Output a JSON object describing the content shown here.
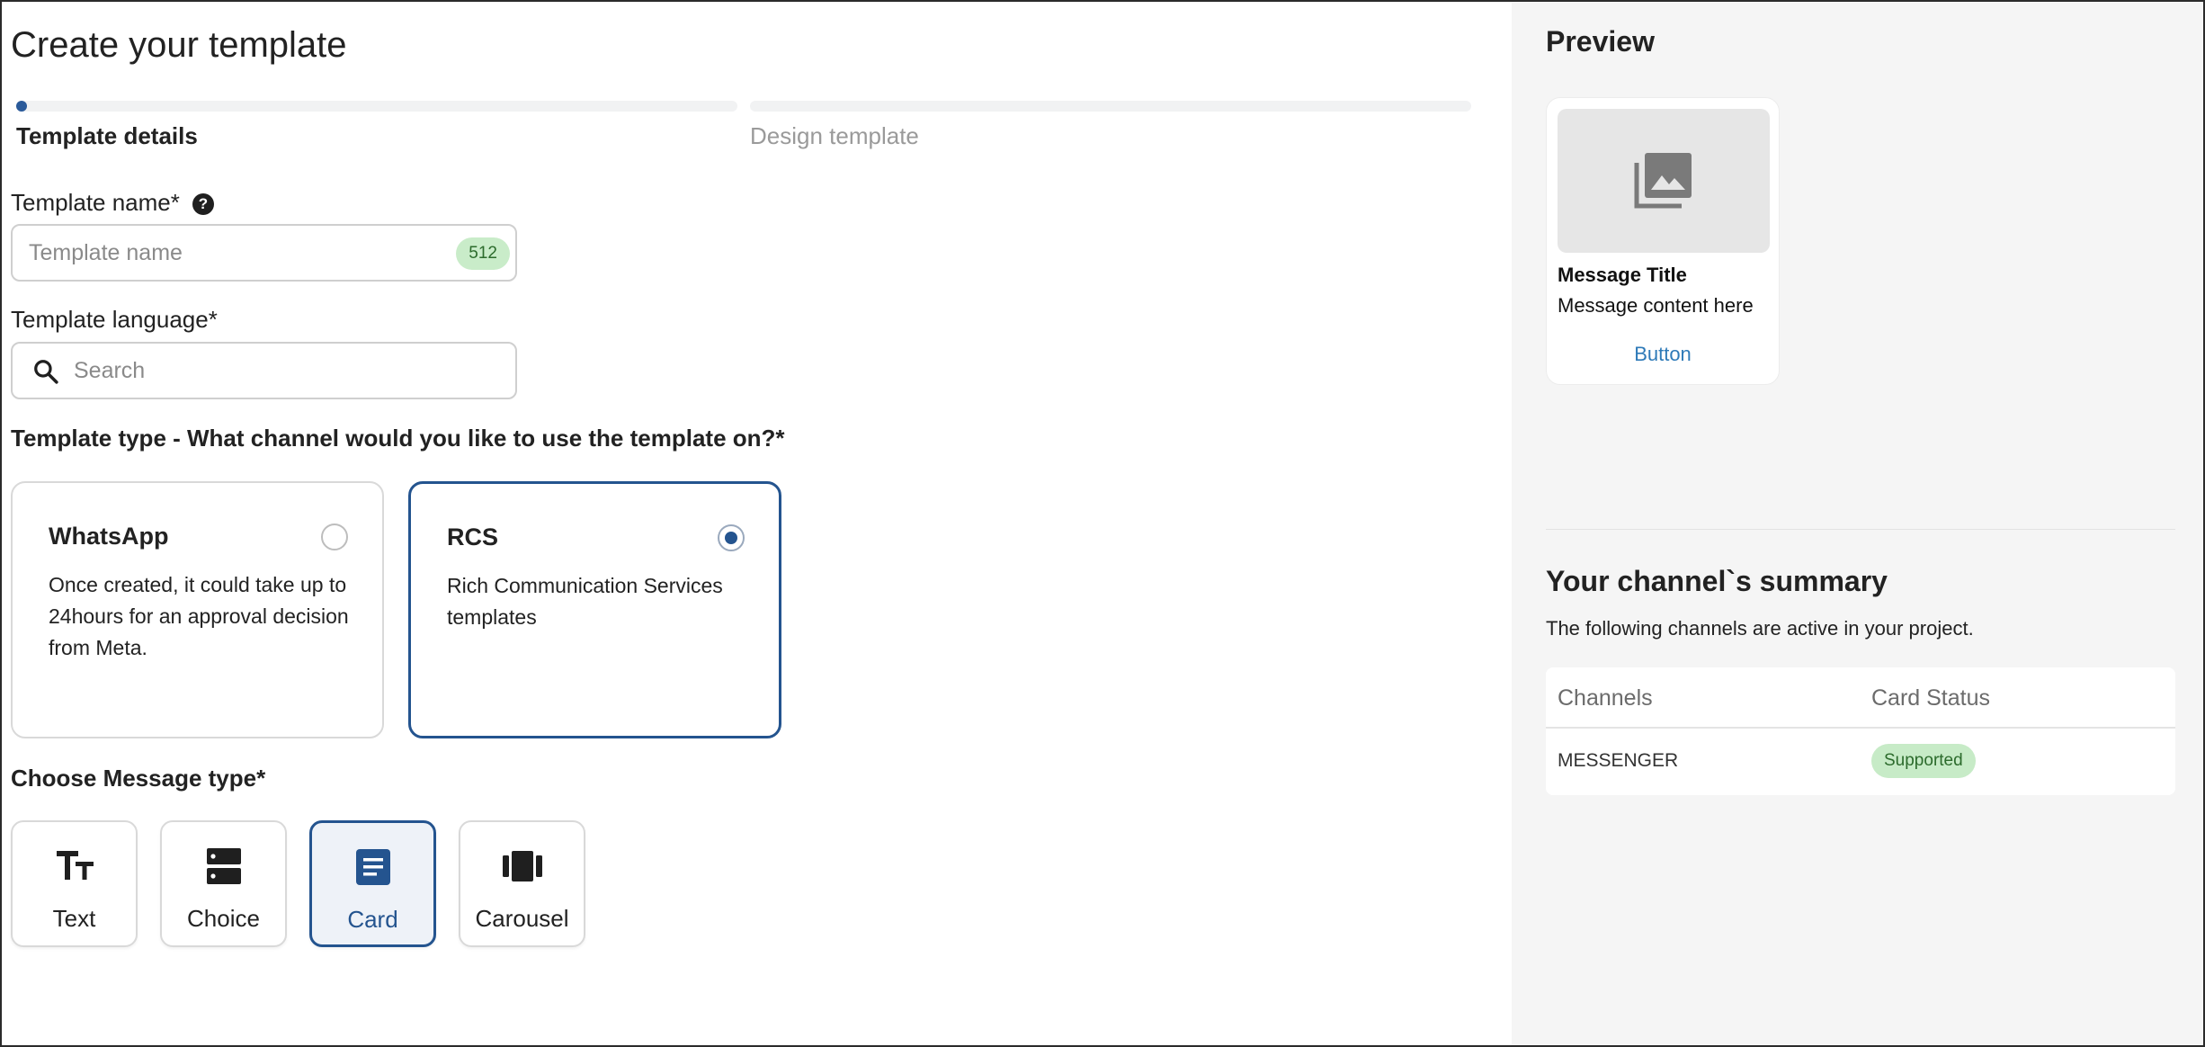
{
  "page_title": "Create your template",
  "steps": [
    {
      "label": "Template details",
      "active": true
    },
    {
      "label": "Design template",
      "active": false
    }
  ],
  "template_name": {
    "label": "Template name*",
    "placeholder": "Template name",
    "value": "",
    "counter": "512",
    "help_icon": "question-circle-icon"
  },
  "template_language": {
    "label": "Template language*",
    "placeholder": "Search",
    "value": "",
    "icon": "search-icon"
  },
  "template_type": {
    "question": "Template type - What channel would you like to use the template on?*",
    "options": [
      {
        "title": "WhatsApp",
        "description": "Once created, it could take up to 24hours for an approval decision from Meta.",
        "selected": false
      },
      {
        "title": "RCS",
        "description": "Rich Communication Services templates",
        "selected": true
      }
    ]
  },
  "message_type": {
    "label": "Choose Message type*",
    "options": [
      {
        "label": "Text",
        "icon": "text-format-icon",
        "selected": false
      },
      {
        "label": "Choice",
        "icon": "choice-list-icon",
        "selected": false
      },
      {
        "label": "Card",
        "icon": "card-article-icon",
        "selected": true
      },
      {
        "label": "Carousel",
        "icon": "carousel-icon",
        "selected": false
      }
    ]
  },
  "preview": {
    "title": "Preview",
    "media_icon": "image-placeholder-icon",
    "card_title": "Message Title",
    "card_content": "Message content here",
    "card_button": "Button"
  },
  "summary": {
    "title": "Your channel`s summary",
    "subtitle": "The following channels are active in your project.",
    "columns": [
      "Channels",
      "Card Status"
    ],
    "rows": [
      {
        "channel": "MESSENGER",
        "status": "Supported"
      }
    ]
  },
  "colors": {
    "accent": "#24548f",
    "link": "#2e7ab8",
    "badge_bg": "#c7ebc7",
    "badge_text": "#2c6b2c",
    "panel_bg": "#f5f5f5"
  }
}
